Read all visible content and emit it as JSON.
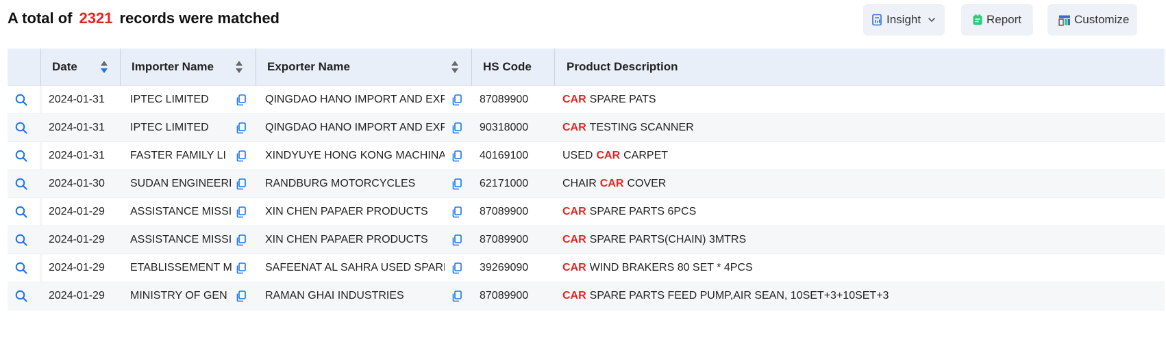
{
  "summary": {
    "prefix": "A total of",
    "count": "2321",
    "suffix": "records were matched"
  },
  "toolbar": {
    "insight": "Insight",
    "report": "Report",
    "customize": "Customize"
  },
  "columns": {
    "date": "Date",
    "importer": "Importer Name",
    "exporter": "Exporter Name",
    "hs": "HS Code",
    "desc": "Product Description"
  },
  "keyword": "CAR",
  "colors": {
    "accent": "#1a73e8",
    "keyword": "#e8231e",
    "header_bg": "#e9eff9",
    "report_icon": "#2ecb7a"
  },
  "rows": [
    {
      "date": "2024-01-31",
      "importer": "IPTEC LIMITED",
      "exporter": "QINGDAO HANO IMPORT AND EXP",
      "hs": "87089900",
      "desc_pre": "",
      "desc_post": "SPARE PATS"
    },
    {
      "date": "2024-01-31",
      "importer": "IPTEC LIMITED",
      "exporter": "QINGDAO HANO IMPORT AND EXP",
      "hs": "90318000",
      "desc_pre": "",
      "desc_post": "TESTING SCANNER"
    },
    {
      "date": "2024-01-31",
      "importer": "FASTER FAMILY LI",
      "exporter": "XINDYUYE HONG KONG MACHINA",
      "hs": "40169100",
      "desc_pre": "USED",
      "desc_post": "CARPET"
    },
    {
      "date": "2024-01-30",
      "importer": "SUDAN ENGINEERI",
      "exporter": "RANDBURG MOTORCYCLES",
      "hs": "62171000",
      "desc_pre": "CHAIR",
      "desc_post": "COVER"
    },
    {
      "date": "2024-01-29",
      "importer": "ASSISTANCE MISSI",
      "exporter": "XIN CHEN PAPAER PRODUCTS",
      "hs": "87089900",
      "desc_pre": "",
      "desc_post": "SPARE PARTS 6PCS"
    },
    {
      "date": "2024-01-29",
      "importer": "ASSISTANCE MISSI",
      "exporter": "XIN CHEN PAPAER PRODUCTS",
      "hs": "87089900",
      "desc_pre": "",
      "desc_post": "SPARE PARTS(CHAIN) 3MTRS"
    },
    {
      "date": "2024-01-29",
      "importer": "ETABLISSEMENT M",
      "exporter": "SAFEENAT AL SAHRA USED SPARE",
      "hs": "39269090",
      "desc_pre": "",
      "desc_post": "WIND BRAKERS 80 SET * 4PCS"
    },
    {
      "date": "2024-01-29",
      "importer": "MINISTRY OF GEN",
      "exporter": "RAMAN GHAI INDUSTRIES",
      "hs": "87089900",
      "desc_pre": "",
      "desc_post": "SPARE PARTS FEED PUMP,AIR SEAN, 10SET+3+10SET+3"
    }
  ]
}
